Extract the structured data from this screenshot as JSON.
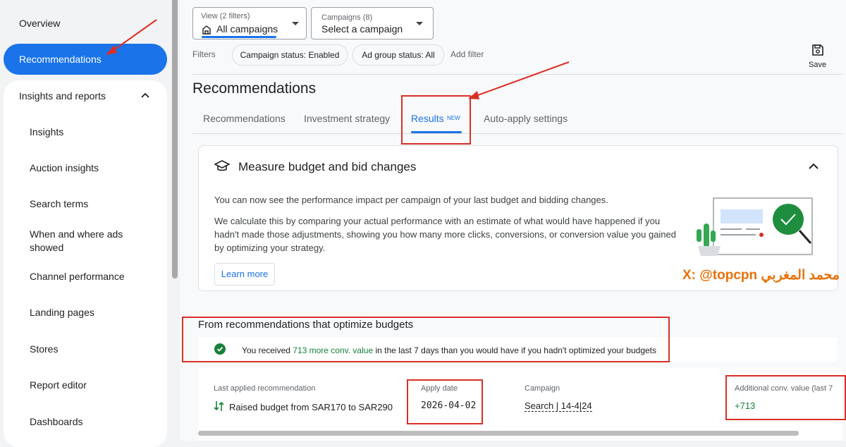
{
  "sidebar": {
    "overview": "Overview",
    "recommendations": "Recommendations",
    "insights_and_reports": "Insights and reports",
    "items": [
      "Insights",
      "Auction insights",
      "Search terms",
      "When and where ads showed",
      "Channel performance",
      "Landing pages",
      "Stores",
      "Report editor",
      "Dashboards"
    ]
  },
  "header": {
    "view_label": "View (2 filters)",
    "view_value": "All campaigns",
    "campaigns_label": "Campaigns (8)",
    "campaigns_value": "Select a campaign",
    "filters_label": "Filters",
    "chips": [
      "Campaign status: Enabled",
      "Ad group status: All"
    ],
    "add_filter": "Add filter",
    "save_label": "Save"
  },
  "page": {
    "title": "Recommendations",
    "tabs": [
      "Recommendations",
      "Investment strategy",
      "Results",
      "Auto-apply settings"
    ],
    "new_badge": "NEW",
    "active_tab": "Results"
  },
  "measure_card": {
    "title": "Measure budget and bid changes",
    "para1": "You can now see the performance impact per campaign of your last budget and bidding changes.",
    "para2": "We calculate this by comparing your actual performance with an estimate of what would have happened if you hadn't made those adjustments, showing you how many more clicks, conversions, or conversion value you gained by optimizing your strategy.",
    "learn_more": "Learn more"
  },
  "watermark": "X: @topcpn محمد المغربي",
  "budget_section": {
    "title": "From recommendations that optimize budgets",
    "msg_prefix": "You received ",
    "msg_highlight": "713 more conv. value",
    "msg_suffix": " in the last 7 days than you would have if you hadn't optimized your budgets"
  },
  "table": {
    "col_last_applied": "Last applied recommendation",
    "last_applied_value": "Raised budget from SAR170 to SAR290",
    "col_apply_date": "Apply date",
    "apply_date_value": "2026-04-02",
    "col_campaign": "Campaign",
    "campaign_value": "Search | 14-4|24",
    "col_additional": "Additional conv. value (last 7",
    "additional_value": "+713"
  },
  "colors": {
    "accent": "#1a73e8",
    "annotation_red": "#d93025",
    "success_green": "#188038",
    "watermark_orange": "#e8710a"
  }
}
